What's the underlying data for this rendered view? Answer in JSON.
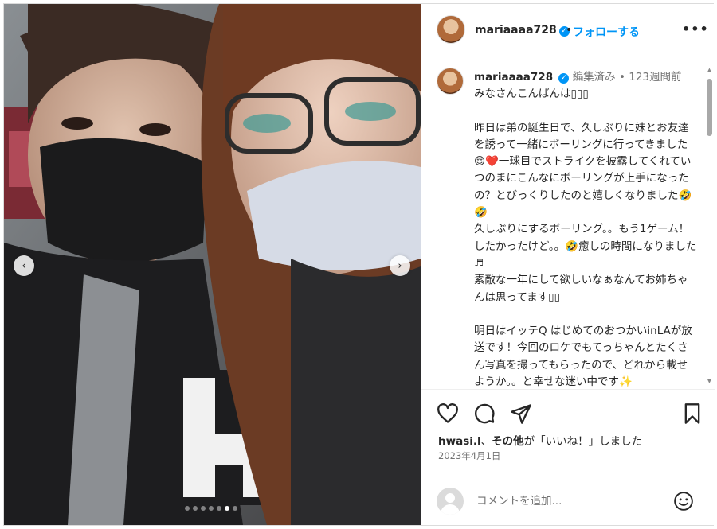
{
  "post": {
    "username": "mariaaaa728",
    "follow_label": "フォローする",
    "separator": "•",
    "more_label": "•••",
    "edited_label": "編集済み",
    "time_ago": "123週間前",
    "caption": "みなさんこんばんは▯▯▯\n\n昨日は弟の誕生日で、久しぶりに妹とお友達を誘って一緒にボーリングに行ってきました😌❤️一球目でストライクを披露してくれていつのまにこんなにボーリングが上手になったの？とびっくりしたのと嬉しくなりました🤣🤣\n久しぶりにするボーリング。。もう1ゲーム！したかったけど。。🤣癒しの時間になりました♬\n素敵な一年にして欲しいなぁなんてお姉ちゃんは思ってます▯▯\n\n明日はイッテQ はじめてのおつかいinLAが放送です！今回のロケでもてっちゃんとたくさん写真を撮ってもらったので、どれから載せようか。。と幸せな迷い中です✨",
    "likes_user": "hwasi.l",
    "likes_text": "、その他が「いいね！」しました",
    "likes_bold": "その他",
    "likes_mid": "、",
    "likes_tail": "が「いいね！」しました",
    "date": "2023年4月1日",
    "comment_placeholder": "コメントを追加..."
  },
  "carousel": {
    "current_index": 6,
    "total": 7
  },
  "icons": {
    "verified": "verified-badge-icon",
    "like": "heart-icon",
    "comment": "comment-icon",
    "share": "share-icon",
    "save": "bookmark-icon",
    "emoji": "emoji-icon",
    "prev": "chevron-left-icon",
    "next": "chevron-right-icon"
  },
  "colors": {
    "link_blue": "#0095f6",
    "text": "#262626",
    "muted": "#737373"
  }
}
